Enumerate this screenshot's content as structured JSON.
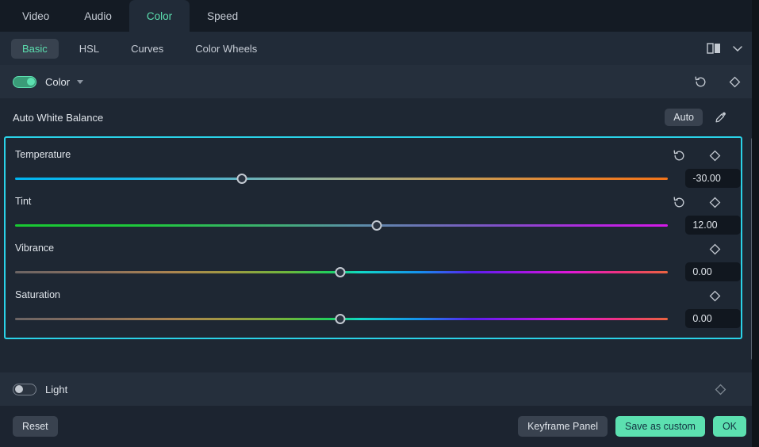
{
  "tabs": [
    {
      "label": "Video",
      "active": false
    },
    {
      "label": "Audio",
      "active": false
    },
    {
      "label": "Color",
      "active": true
    },
    {
      "label": "Speed",
      "active": false
    }
  ],
  "subtabs": [
    {
      "label": "Basic",
      "active": true
    },
    {
      "label": "HSL",
      "active": false
    },
    {
      "label": "Curves",
      "active": false
    },
    {
      "label": "Color Wheels",
      "active": false
    }
  ],
  "subbar_icons": {
    "compare": "split-compare-icon",
    "chevron": "chevron-down-icon"
  },
  "color_section": {
    "title": "Color",
    "toggle_on": true,
    "reset_icon": "reset-icon",
    "keyframe_icon": "keyframe-diamond-icon"
  },
  "auto_white_balance": {
    "label": "Auto White Balance",
    "auto_button": "Auto",
    "eyedropper_icon": "eyedropper-icon"
  },
  "sliders": [
    {
      "label": "Temperature",
      "value": "-30.00",
      "thumb_pct": 34.7,
      "has_reset": true,
      "has_keyframe": true,
      "gradient": "linear-gradient(90deg,#00b4f0 0%,#18b7e8 18%,#5cb2c4 33%,#8fae9a 45%,#a8a87e 56%,#c99a52 70%,#e8822c 86%,#f2741a 100%)"
    },
    {
      "label": "Tint",
      "value": "12.00",
      "thumb_pct": 55.4,
      "has_reset": true,
      "has_keyframe": true,
      "gradient": "linear-gradient(90deg,#19c832 0%,#1fc83c 20%,#3fae74 40%,#5b8fa8 52%,#6a74b4 62%,#8050c8 74%,#b328e0 88%,#d41ae8 100%)"
    },
    {
      "label": "Vibrance",
      "value": "0.00",
      "thumb_pct": 49.8,
      "has_reset": false,
      "has_keyframe": true,
      "gradient": "linear-gradient(90deg,#6b6464 0%,#8a6f5e 12%,#ab8450 24%,#a09a42 33%,#6bb83c 42%,#22cf5c 48%,#11d8c8 53%,#1590ee 62%,#5a1ff0 70%,#9a16e8 77%,#e018d8 85%,#f0347a 93%,#ea6440 100%)"
    },
    {
      "label": "Saturation",
      "value": "0.00",
      "thumb_pct": 49.8,
      "has_reset": false,
      "has_keyframe": true,
      "gradient": "linear-gradient(90deg,#6b6464 0%,#8a6f5e 12%,#ab8450 24%,#a09a42 33%,#6bb83c 42%,#22cf5c 48%,#11d8c8 53%,#1590ee 62%,#5a1ff0 70%,#9a16e8 77%,#e018d8 85%,#f0347a 93%,#ea6440 100%)"
    }
  ],
  "light_section": {
    "title": "Light",
    "toggle_on": false,
    "keyframe_icon": "keyframe-diamond-icon"
  },
  "footer": {
    "reset_label": "Reset",
    "keyframe_panel_label": "Keyframe Panel",
    "save_custom_label": "Save as custom",
    "ok_label": "OK"
  },
  "colors": {
    "accent_teal": "#5ce0b0",
    "highlight_border": "#2ad2e8",
    "panel_bg": "#1e2733",
    "header_bg": "#252f3c"
  }
}
